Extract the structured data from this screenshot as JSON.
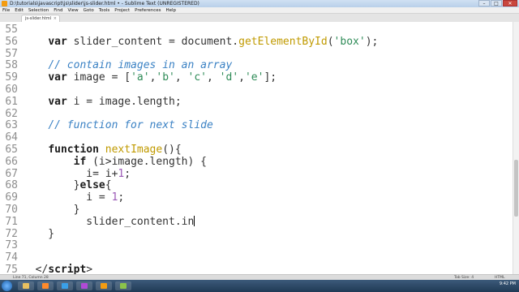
{
  "window": {
    "title": "D:\\tutorials\\javascript\\js\\slider\\js-slider.html • - Sublime Text (UNREGISTERED)",
    "controls": {
      "minimize": "–",
      "maximize": "□",
      "close": "✕"
    }
  },
  "menu": [
    "File",
    "Edit",
    "Selection",
    "Find",
    "View",
    "Goto",
    "Tools",
    "Project",
    "Preferences",
    "Help"
  ],
  "tab": {
    "label": "js-slider.html",
    "close": "×"
  },
  "editor": {
    "lines": [
      {
        "num": "55",
        "text": ""
      },
      {
        "num": "56",
        "tokens": [
          {
            "t": "    ",
            "c": ""
          },
          {
            "t": "var",
            "c": "kw"
          },
          {
            "t": " slider_content ",
            "c": ""
          },
          {
            "t": "=",
            "c": ""
          },
          {
            "t": " document.",
            "c": ""
          },
          {
            "t": "getElementById",
            "c": "fn"
          },
          {
            "t": "(",
            "c": ""
          },
          {
            "t": "'box'",
            "c": "str"
          },
          {
            "t": ");",
            "c": ""
          }
        ]
      },
      {
        "num": "57",
        "text": ""
      },
      {
        "num": "58",
        "tokens": [
          {
            "t": "    ",
            "c": ""
          },
          {
            "t": "// contain images in an array",
            "c": "cm"
          }
        ]
      },
      {
        "num": "59",
        "tokens": [
          {
            "t": "    ",
            "c": ""
          },
          {
            "t": "var",
            "c": "kw"
          },
          {
            "t": " image = [",
            "c": ""
          },
          {
            "t": "'a'",
            "c": "str"
          },
          {
            "t": ",",
            "c": ""
          },
          {
            "t": "'b'",
            "c": "str"
          },
          {
            "t": ", ",
            "c": ""
          },
          {
            "t": "'c'",
            "c": "str"
          },
          {
            "t": ", ",
            "c": ""
          },
          {
            "t": "'d'",
            "c": "str"
          },
          {
            "t": ",",
            "c": ""
          },
          {
            "t": "'e'",
            "c": "str"
          },
          {
            "t": "];",
            "c": ""
          }
        ]
      },
      {
        "num": "60",
        "text": ""
      },
      {
        "num": "61",
        "tokens": [
          {
            "t": "    ",
            "c": ""
          },
          {
            "t": "var",
            "c": "kw"
          },
          {
            "t": " i = image.length;",
            "c": ""
          }
        ]
      },
      {
        "num": "62",
        "text": ""
      },
      {
        "num": "63",
        "tokens": [
          {
            "t": "    ",
            "c": ""
          },
          {
            "t": "// function for next slide",
            "c": "cm"
          }
        ]
      },
      {
        "num": "64",
        "text": ""
      },
      {
        "num": "65",
        "tokens": [
          {
            "t": "    ",
            "c": ""
          },
          {
            "t": "function",
            "c": "kw"
          },
          {
            "t": " ",
            "c": ""
          },
          {
            "t": "nextImage",
            "c": "fn"
          },
          {
            "t": "(){",
            "c": ""
          }
        ]
      },
      {
        "num": "66",
        "tokens": [
          {
            "t": "        ",
            "c": ""
          },
          {
            "t": "if",
            "c": "kw"
          },
          {
            "t": " (i>image.length) {",
            "c": ""
          }
        ]
      },
      {
        "num": "67",
        "tokens": [
          {
            "t": "          i= i+",
            "c": ""
          },
          {
            "t": "1",
            "c": "num"
          },
          {
            "t": ";",
            "c": ""
          }
        ]
      },
      {
        "num": "68",
        "tokens": [
          {
            "t": "        }",
            "c": ""
          },
          {
            "t": "else",
            "c": "kw"
          },
          {
            "t": "{",
            "c": ""
          }
        ]
      },
      {
        "num": "69",
        "tokens": [
          {
            "t": "          i = ",
            "c": ""
          },
          {
            "t": "1",
            "c": "num"
          },
          {
            "t": ";",
            "c": ""
          }
        ]
      },
      {
        "num": "70",
        "tokens": [
          {
            "t": "        }",
            "c": ""
          }
        ]
      },
      {
        "num": "71",
        "tokens": [
          {
            "t": "          slider_content.in",
            "c": ""
          }
        ],
        "cursor": true
      },
      {
        "num": "72",
        "tokens": [
          {
            "t": "    }",
            "c": ""
          }
        ]
      },
      {
        "num": "73",
        "text": ""
      },
      {
        "num": "74",
        "text": ""
      },
      {
        "num": "75",
        "tokens": [
          {
            "t": "  </",
            "c": ""
          },
          {
            "t": "script",
            "c": "tg"
          },
          {
            "t": ">",
            "c": ""
          }
        ]
      }
    ]
  },
  "status": {
    "position": "Line 71, Column 28",
    "tab_size": "Tab Size: 4",
    "syntax": "HTML"
  },
  "clock": {
    "time": "9:42 PM"
  },
  "colors": {
    "string": "#2e8b57",
    "function": "#c09a00",
    "comment": "#3b82c4",
    "number": "#9b59b6"
  }
}
